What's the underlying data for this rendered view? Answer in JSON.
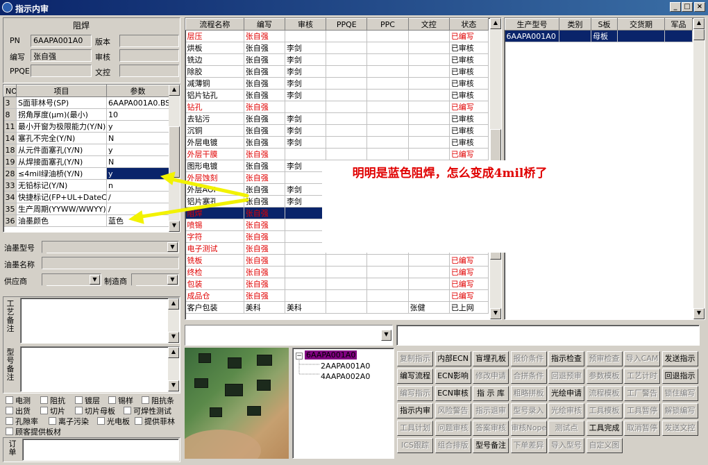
{
  "window": {
    "title": "指示内审",
    "min": "_",
    "max": "□",
    "close": "×"
  },
  "left": {
    "section_title": "阻焊",
    "pn_label": "PN",
    "pn_value": "6AAPA001A0",
    "version_label": "版本",
    "version_value": "",
    "writer_label": "编写",
    "writer_value": "张自强",
    "review_label": "审核",
    "review_value": "",
    "ppqe_label": "PPQE",
    "ppqe_value": "",
    "doc_label": "文控",
    "doc_value": "",
    "param_headers": [
      "NO",
      "项目",
      "参数"
    ],
    "params": [
      {
        "no": "3",
        "item": "S面菲林号(SP)",
        "value": "6AAPA001A0.BS"
      },
      {
        "no": "8",
        "item": "拐角厚度(μm)(最小)",
        "value": "10"
      },
      {
        "no": "11",
        "item": "最小开窗为极限能力(Y/N)",
        "value": "y"
      },
      {
        "no": "14",
        "item": "塞孔不完全(Y/N)",
        "value": "N"
      },
      {
        "no": "18",
        "item": "从元件面塞孔(Y/N)",
        "value": "y"
      },
      {
        "no": "19",
        "item": "从焊接面塞孔(Y/N)",
        "value": "N"
      },
      {
        "no": "28",
        "item": "≤4mil绿油桥(Y/N)",
        "value": "y"
      },
      {
        "no": "33",
        "item": "无铅标记(Y/N)",
        "value": "n"
      },
      {
        "no": "34",
        "item": "快捷标记(FP+UL+DateCode)",
        "value": "/"
      },
      {
        "no": "35",
        "item": "生产周期(YYWW/WWYY)",
        "value": "/"
      },
      {
        "no": "36",
        "item": "油墨颜色",
        "value": "蓝色"
      }
    ],
    "selected_param_index": 6,
    "ink_model_label": "油墨型号",
    "ink_model_value": "",
    "ink_name_label": "油墨名称",
    "ink_name_value": "",
    "supplier_label": "供应商",
    "supplier_value": "",
    "maker_label": "制造商",
    "maker_value": "",
    "craft_note_label": "工艺备注",
    "model_note_label": "型号备注",
    "checks": [
      "电测",
      "阻抗",
      "镀层",
      "锡样",
      "阻抗条",
      "出货",
      "切片",
      "切片母板",
      "可焊性测试",
      "孔隙率",
      "离子污染",
      "光电板",
      "提供菲林",
      "顾客提供板材"
    ],
    "order_note_label": "订单"
  },
  "flow": {
    "headers": [
      "流程名称",
      "编写",
      "审核",
      "PPQE",
      "PPC",
      "文控",
      "状态"
    ],
    "rows": [
      {
        "name": "层压",
        "writer": "张自强",
        "reviewer": "",
        "ppqe": "",
        "ppc": "",
        "doc": "",
        "status": "已编写",
        "red": true
      },
      {
        "name": "烘板",
        "writer": "张自强",
        "reviewer": "李剑",
        "ppqe": "",
        "ppc": "",
        "doc": "",
        "status": "已审核",
        "red": false
      },
      {
        "name": "铣边",
        "writer": "张自强",
        "reviewer": "李剑",
        "ppqe": "",
        "ppc": "",
        "doc": "",
        "status": "已审核",
        "red": false
      },
      {
        "name": "除胶",
        "writer": "张自强",
        "reviewer": "李剑",
        "ppqe": "",
        "ppc": "",
        "doc": "",
        "status": "已审核",
        "red": false
      },
      {
        "name": "减薄铜",
        "writer": "张自强",
        "reviewer": "李剑",
        "ppqe": "",
        "ppc": "",
        "doc": "",
        "status": "已审核",
        "red": false
      },
      {
        "name": "铝片钻孔",
        "writer": "张自强",
        "reviewer": "李剑",
        "ppqe": "",
        "ppc": "",
        "doc": "",
        "status": "已审核",
        "red": false
      },
      {
        "name": "钻孔",
        "writer": "张自强",
        "reviewer": "",
        "ppqe": "",
        "ppc": "",
        "doc": "",
        "status": "已编写",
        "red": true
      },
      {
        "name": "去钻污",
        "writer": "张自强",
        "reviewer": "李剑",
        "ppqe": "",
        "ppc": "",
        "doc": "",
        "status": "已审核",
        "red": false
      },
      {
        "name": "沉铜",
        "writer": "张自强",
        "reviewer": "李剑",
        "ppqe": "",
        "ppc": "",
        "doc": "",
        "status": "已审核",
        "red": false
      },
      {
        "name": "外层电镀",
        "writer": "张自强",
        "reviewer": "李剑",
        "ppqe": "",
        "ppc": "",
        "doc": "",
        "status": "已审核",
        "red": false
      },
      {
        "name": "外层干膜",
        "writer": "张自强",
        "reviewer": "",
        "ppqe": "",
        "ppc": "",
        "doc": "",
        "status": "已编写",
        "red": true
      },
      {
        "name": "图形电镀",
        "writer": "张自强",
        "reviewer": "李剑",
        "ppqe": "",
        "ppc": "",
        "doc": "",
        "status": "",
        "red": false
      },
      {
        "name": "外层蚀刻",
        "writer": "张自强",
        "reviewer": "",
        "ppqe": "",
        "ppc": "",
        "doc": "",
        "status": "",
        "red": true
      },
      {
        "name": "外层AOI",
        "writer": "张自强",
        "reviewer": "李剑",
        "ppqe": "",
        "ppc": "",
        "doc": "",
        "status": "",
        "red": false
      },
      {
        "name": "铝片塞孔",
        "writer": "张自强",
        "reviewer": "李剑",
        "ppqe": "",
        "ppc": "",
        "doc": "",
        "status": "",
        "red": false
      },
      {
        "name": "阻焊",
        "writer": "张自强",
        "reviewer": "",
        "ppqe": "",
        "ppc": "",
        "doc": "",
        "status": "",
        "red": true,
        "selected": true
      },
      {
        "name": "喷锡",
        "writer": "张自强",
        "reviewer": "",
        "ppqe": "",
        "ppc": "",
        "doc": "",
        "status": "",
        "red": true
      },
      {
        "name": "字符",
        "writer": "张自强",
        "reviewer": "",
        "ppqe": "",
        "ppc": "",
        "doc": "",
        "status": "",
        "red": true
      },
      {
        "name": "电子测试",
        "writer": "张自强",
        "reviewer": "",
        "ppqe": "",
        "ppc": "",
        "doc": "",
        "status": "",
        "red": true
      },
      {
        "name": "铣板",
        "writer": "张自强",
        "reviewer": "",
        "ppqe": "",
        "ppc": "",
        "doc": "",
        "status": "已编写",
        "red": true
      },
      {
        "name": "终检",
        "writer": "张自强",
        "reviewer": "",
        "ppqe": "",
        "ppc": "",
        "doc": "",
        "status": "已编写",
        "red": true
      },
      {
        "name": "包装",
        "writer": "张自强",
        "reviewer": "",
        "ppqe": "",
        "ppc": "",
        "doc": "",
        "status": "已编写",
        "red": true
      },
      {
        "name": "成品仓",
        "writer": "张自强",
        "reviewer": "",
        "ppqe": "",
        "ppc": "",
        "doc": "",
        "status": "已编写",
        "red": true
      },
      {
        "name": "客户包装",
        "writer": "美科",
        "reviewer": "美科",
        "ppqe": "",
        "ppc": "",
        "doc": "张健",
        "status": "已上网",
        "red": false
      }
    ]
  },
  "annotation": {
    "text": "明明是蓝色阻焊，怎么变成4mil桥了",
    "color": "#e00000"
  },
  "product": {
    "headers": [
      "生产型号",
      "类别",
      "S板",
      "交货期",
      "军品"
    ],
    "rows": [
      {
        "model": "6AAPA001A0",
        "type": "",
        "s_board": "母板",
        "delivery": "",
        "military": ""
      }
    ]
  },
  "tree": {
    "root": "6AAPA001A0",
    "expander": "−",
    "children": [
      "2AAPA001A0",
      "4AAPA002A0"
    ]
  },
  "buttons": [
    [
      "复制指示",
      "内部ECN",
      "盲埋孔板",
      "报价条件",
      "指示检查",
      "预审检查",
      "导入CAM",
      "发送指示"
    ],
    [
      "编写流程",
      "ECN影响",
      "修改申请",
      "合拼条件",
      "回退预审",
      "参数模板",
      "工艺计时",
      "回退指示"
    ],
    [
      "编写指示",
      "ECN审核",
      "指 示 库",
      "粗略拼板",
      "光绘申请",
      "流程模板",
      "工厂警告",
      "锁住编写"
    ],
    [
      "指示内审",
      "风险警告",
      "指示退审",
      "型号录入",
      "光绘审核",
      "工具模板",
      "工具暂停",
      "解锁编写"
    ],
    [
      "工具计划",
      "问题审核",
      "答案审核",
      "审核Nope",
      "测试点",
      "工具完成",
      "取消暂停",
      "发送文控"
    ],
    [
      "ICS跟踪",
      "组合排版",
      "型号备注",
      "下单差异",
      "导入型号",
      "自定义图",
      "",
      ""
    ]
  ],
  "enabled_buttons": [
    "内部ECN",
    "盲埋孔板",
    "指示检查",
    "发送指示",
    "编写流程",
    "ECN影响",
    "回退指示",
    "ECN审核",
    "指 示 库",
    "光绘申请",
    "指示内审",
    "工具完成",
    "型号备注"
  ],
  "colors": {
    "selection": "#0a246a",
    "red_text": "#e00000",
    "title_bar": "#0a246a",
    "tree_root_bg": "#800080"
  }
}
